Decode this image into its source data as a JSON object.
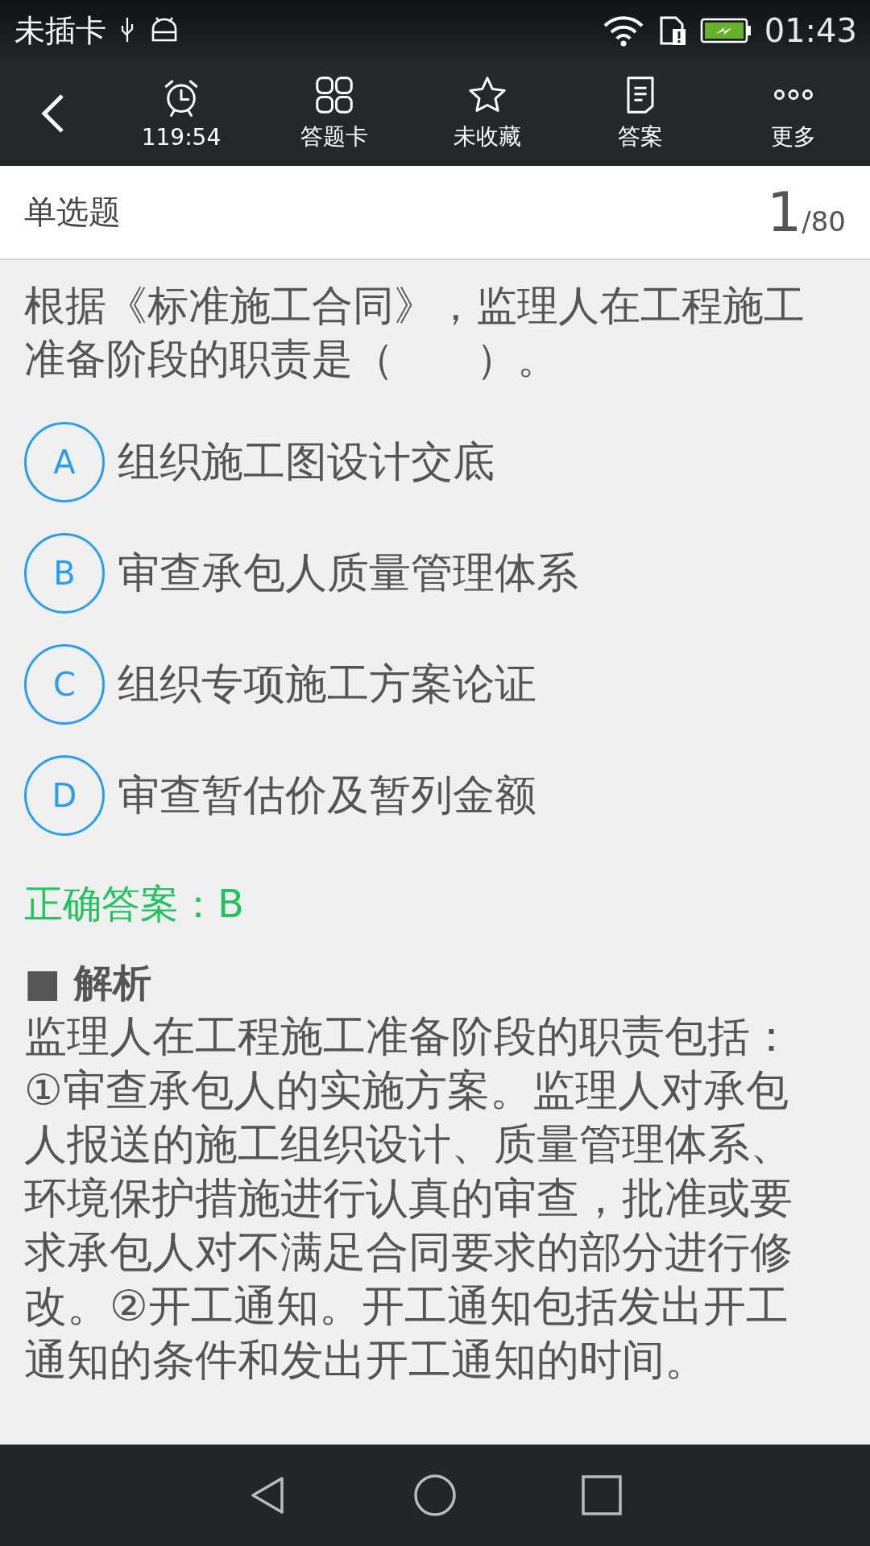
{
  "status_bar": {
    "carrier": "未插卡",
    "time": "01:43"
  },
  "toolbar": {
    "items": [
      {
        "kind": "timer",
        "label": "119:54"
      },
      {
        "kind": "grid",
        "label": "答题卡"
      },
      {
        "kind": "star",
        "label": "未收藏"
      },
      {
        "kind": "note",
        "label": "答案"
      },
      {
        "kind": "more",
        "label": "更多"
      }
    ]
  },
  "header": {
    "type": "单选题",
    "current": "1",
    "total": "/80"
  },
  "question": "根据《标准施工合同》，监理人在工程施工准备阶段的职责是（　　）。",
  "options": [
    {
      "letter": "A",
      "text": "组织施工图设计交底",
      "selected": false
    },
    {
      "letter": "B",
      "text": "审查承包人质量管理体系",
      "selected": false
    },
    {
      "letter": "C",
      "text": "组织专项施工方案论证",
      "selected": false
    },
    {
      "letter": "D",
      "text": "审查暂估价及暂列金额",
      "selected": false
    }
  ],
  "correct_answer": "正确答案：B",
  "analysis": {
    "heading": "■ 解析",
    "text": "监理人在工程施工准备阶段的职责包括：①审查承包人的实施方案。监理人对承包人报送的施工组织设计、质量管理体系、环境保护措施进行认真的审查，批准或要求承包人对不满足合同要求的部分进行修改。②开工通知。开工通知包括发出开工通知的条件和发出开工通知的时间。"
  }
}
